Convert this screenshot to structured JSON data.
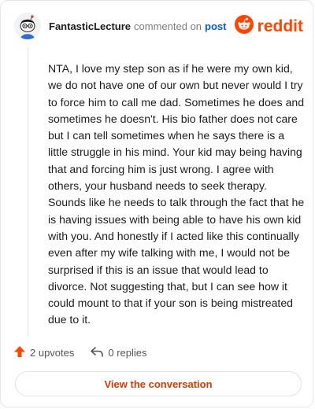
{
  "header": {
    "username": "FantasticLecture",
    "action_text": "commented on",
    "post_link_label": "post",
    "brand_text": "reddit"
  },
  "comment": {
    "text": "NTA, I love my step son as if he were my own kid, we do not have one of our own but never would I try to force him to call me dad. Sometimes he does and sometimes he doesn't. His bio father does not care but I can tell sometimes when he says there is a little struggle in his mind. Your kid may being having that and forcing him is just wrong. I agree with others, your husband needs to seek therapy. Sounds like he needs to talk through the fact that he is having issues with being able to have his own kid with you. And honestly if I acted like this continually even after my wife talking with me, I would not be surprised if this is an issue that would lead to divorce. Not suggesting that, but I can see how it could mount to that if your son is being mistreated due to it."
  },
  "actions": {
    "upvotes_label": "2 upvotes",
    "replies_label": "0 replies"
  },
  "cta": {
    "label": "View the conversation"
  },
  "colors": {
    "brand": "#ff4500",
    "link": "#0a5bd8",
    "cta_text": "#d93a00"
  },
  "icons": {
    "avatar": "snoo-avatar-icon",
    "logo": "reddit-logo-icon",
    "upvote": "upvote-arrow-icon",
    "reply": "reply-arrow-icon"
  }
}
